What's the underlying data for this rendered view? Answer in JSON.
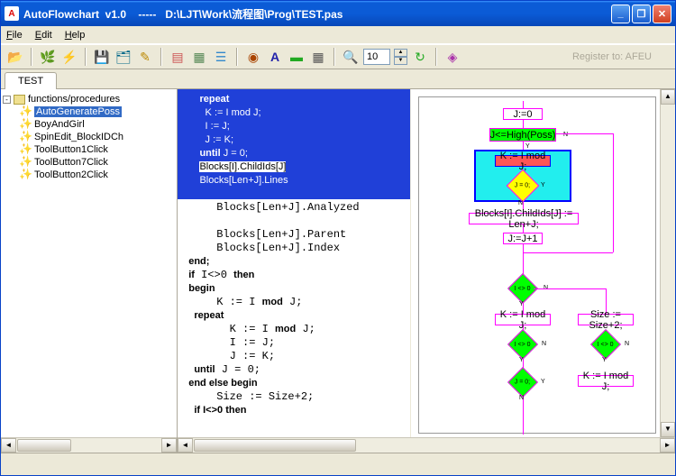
{
  "window": {
    "title": "AutoFlowchart  v1.0    -----   D:\\LJT\\Work\\流程图\\Prog\\TEST.pas"
  },
  "menu": {
    "file": "File",
    "edit": "Edit",
    "help": "Help"
  },
  "toolbar": {
    "zoom": "10",
    "register": "Register to: AFEU"
  },
  "tab": {
    "label": "TEST"
  },
  "tree": {
    "root": "functions/procedures",
    "items": [
      {
        "label": "AutoGeneratePoss",
        "sel": true
      },
      {
        "label": "BoyAndGirl"
      },
      {
        "label": "SpinEdit_BlockIDCh"
      },
      {
        "label": "ToolButton1Click"
      },
      {
        "label": "ToolButton7Click"
      },
      {
        "label": "ToolButton2Click"
      }
    ]
  },
  "code": {
    "l1": "        repeat",
    "l2": "          K := I mod J;",
    "l3": "          I := J;",
    "l4": "          J := K;",
    "l5a": "        until",
    "l5b": " J = 0;",
    "l6": "        Blocks[I].ChildIds[J]",
    "l7": "        Blocks[Len+J].Lines",
    "l8": "",
    "l9": "      Blocks[Len+J].Analyzed",
    "l10": "",
    "l11": "      Blocks[Len+J].Parent",
    "l12": "      Blocks[Len+J].Index ",
    "l13": "    end;",
    "l14a": "    if",
    "l14b": " I<>0 ",
    "l14c": "then",
    "l15": "    begin",
    "l16a": "      K := I ",
    "l16b": "mod",
    "l16c": " J;",
    "l17": "      repeat",
    "l18a": "        K := I ",
    "l18b": "mod",
    "l18c": " J;",
    "l19": "        I := J;",
    "l20": "        J := K;",
    "l21a": "      until",
    "l21b": " J = 0;",
    "l22": "    end else begin",
    "l23": "      Size := Size+2;",
    "l24": "      if I<>0 then"
  },
  "flow": {
    "n1": "J:=0",
    "n2": "J<=High(Poss)",
    "n3": "K := I mod J;",
    "n4": "J = 0;",
    "n5": "Blocks[I].ChildIds[J] := Len+J;",
    "n6": "J:=J+1",
    "n7": "I <> 0",
    "n8": "K := I mod J;",
    "n9": "Size := Size+2;",
    "n10": "I <> 0",
    "n11": "I <> 0",
    "n12": "J = 0;",
    "n13": "K := I mod J;",
    "y": "Y",
    "n": "N"
  }
}
